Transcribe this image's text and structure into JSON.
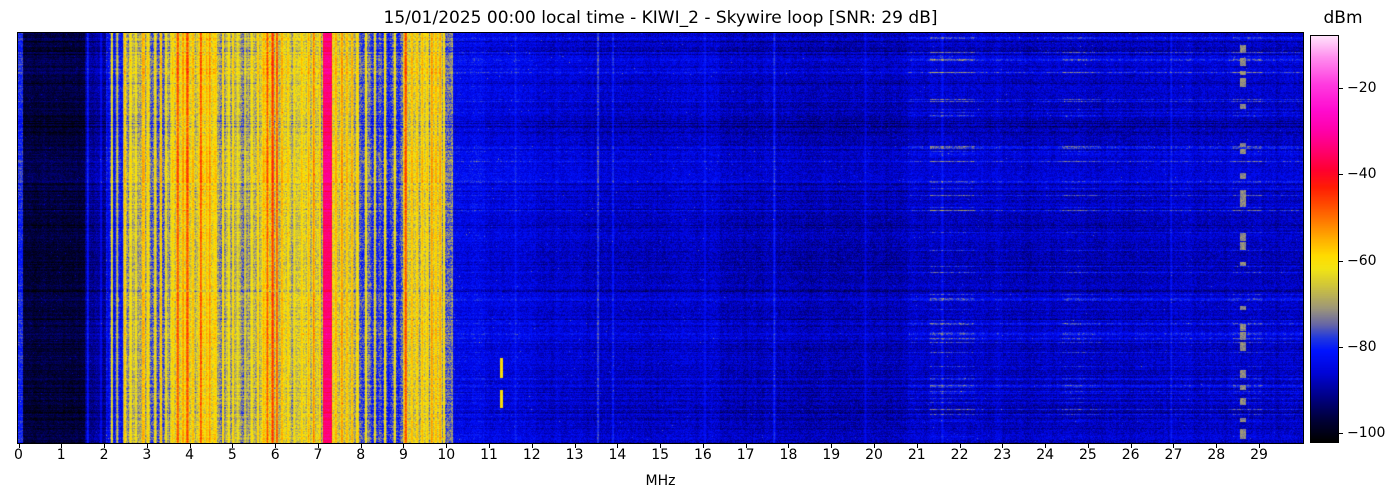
{
  "chart_data": {
    "type": "heatmap",
    "subtype": "spectrogram-waterfall",
    "title": "15/01/2025 00:00 local time - KIWI_2 - Skywire loop [SNR: 29 dB]",
    "xlabel": "MHz",
    "colorbar_label": "dBm",
    "x_range": [
      0,
      30
    ],
    "x_ticks": [
      0,
      1,
      2,
      3,
      4,
      5,
      6,
      7,
      8,
      9,
      10,
      11,
      12,
      13,
      14,
      15,
      16,
      17,
      18,
      19,
      20,
      21,
      22,
      23,
      24,
      25,
      26,
      27,
      28,
      29
    ],
    "value_unit": "dBm",
    "value_range": [
      -102,
      -8
    ],
    "colorbar_ticks": [
      -20,
      -40,
      -60,
      -80,
      -100
    ],
    "colorbar_tick_labels": [
      "−20",
      "−40",
      "−60",
      "−80",
      "−100"
    ],
    "legend_position": "right-colorbar",
    "grid": false,
    "colormap_stops": [
      [
        -102,
        "#000000"
      ],
      [
        -97,
        "#000038"
      ],
      [
        -92,
        "#000080"
      ],
      [
        -86,
        "#0004d8"
      ],
      [
        -81,
        "#0013ff"
      ],
      [
        -78,
        "#2038e0"
      ],
      [
        -75,
        "#6464a8"
      ],
      [
        -71,
        "#9e9878"
      ],
      [
        -66,
        "#cfc43c"
      ],
      [
        -62,
        "#f2e414"
      ],
      [
        -59,
        "#ffdc00"
      ],
      [
        -55,
        "#ffae00"
      ],
      [
        -51,
        "#ff7c00"
      ],
      [
        -47,
        "#ff4a00"
      ],
      [
        -43,
        "#ff1c04"
      ],
      [
        -39,
        "#ff0030"
      ],
      [
        -35,
        "#ff0068"
      ],
      [
        -30,
        "#ff00a8"
      ],
      [
        -25,
        "#ff0cd0"
      ],
      [
        -19,
        "#ff3ce0"
      ],
      [
        -13,
        "#ff8cee"
      ],
      [
        -8,
        "#ffe2fb"
      ]
    ],
    "bands_from_to_base_noise_jitter": [
      [
        -0.5,
        0.1,
        -79,
        3.0,
        1.0
      ],
      [
        0.1,
        1.55,
        -96,
        2.5,
        1.5
      ],
      [
        1.55,
        2.05,
        -90,
        3.0,
        2.0
      ],
      [
        2.05,
        2.5,
        -81,
        4.0,
        4.0
      ],
      [
        2.5,
        3.08,
        -69,
        5.0,
        6.0
      ],
      [
        3.08,
        3.55,
        -74,
        5.0,
        7.0
      ],
      [
        3.55,
        4.65,
        -63,
        5.0,
        7.0
      ],
      [
        4.65,
        5.45,
        -70,
        5.0,
        8.0
      ],
      [
        5.45,
        6.25,
        -65,
        5.0,
        8.0
      ],
      [
        6.25,
        7.14,
        -67,
        5.0,
        8.0
      ],
      [
        7.14,
        7.32,
        -45,
        4.0,
        4.0
      ],
      [
        7.32,
        7.95,
        -65,
        5.0,
        7.0
      ],
      [
        7.95,
        9.0,
        -75,
        5.0,
        6.0
      ],
      [
        9.0,
        9.95,
        -66,
        5.0,
        8.0
      ],
      [
        9.95,
        10.15,
        -73,
        5.0,
        5.0
      ],
      [
        10.15,
        10.9,
        -83,
        3.5,
        1.2
      ],
      [
        10.9,
        12.1,
        -84.5,
        3.5,
        1.2
      ],
      [
        12.1,
        13.2,
        -85.5,
        3.5,
        1.2
      ],
      [
        13.2,
        15.2,
        -86.5,
        3.5,
        1.2
      ],
      [
        15.2,
        16.4,
        -86,
        3.5,
        1.2
      ],
      [
        16.4,
        18.3,
        -87.5,
        3.5,
        1.2
      ],
      [
        18.3,
        20.8,
        -88,
        3.5,
        1.2
      ],
      [
        20.8,
        23.0,
        -86.5,
        3.5,
        1.5
      ],
      [
        23.0,
        26.5,
        -87,
        3.5,
        1.5
      ],
      [
        26.5,
        30.1,
        -86.5,
        3.5,
        1.5
      ]
    ],
    "signals_f_hw_level": [
      [
        1.62,
        0.008,
        -80
      ],
      [
        1.93,
        0.008,
        -83
      ],
      [
        2.18,
        0.01,
        -61
      ],
      [
        2.31,
        0.008,
        -66
      ],
      [
        2.48,
        0.012,
        -56
      ],
      [
        2.62,
        0.012,
        -60
      ],
      [
        2.75,
        0.012,
        -62
      ],
      [
        2.92,
        0.02,
        -55
      ],
      [
        3.02,
        0.012,
        -58
      ],
      [
        3.2,
        0.01,
        -60
      ],
      [
        3.33,
        0.012,
        -57
      ],
      [
        3.45,
        0.01,
        -62
      ],
      [
        3.6,
        0.01,
        -57
      ],
      [
        3.72,
        0.015,
        -47
      ],
      [
        3.85,
        0.01,
        -53
      ],
      [
        3.95,
        0.015,
        -46
      ],
      [
        4.08,
        0.01,
        -56
      ],
      [
        4.26,
        0.012,
        -47
      ],
      [
        4.4,
        0.01,
        -55
      ],
      [
        4.47,
        0.01,
        -52
      ],
      [
        4.6,
        0.01,
        -57
      ],
      [
        4.78,
        0.01,
        -59
      ],
      [
        4.92,
        0.01,
        -61
      ],
      [
        5.02,
        0.008,
        -58
      ],
      [
        5.12,
        0.01,
        -62
      ],
      [
        5.3,
        0.01,
        -64
      ],
      [
        5.45,
        0.01,
        -60
      ],
      [
        5.6,
        0.01,
        -58
      ],
      [
        5.73,
        0.012,
        -55
      ],
      [
        5.82,
        0.012,
        -47
      ],
      [
        5.94,
        0.014,
        -44
      ],
      [
        6.04,
        0.012,
        -48
      ],
      [
        6.16,
        0.01,
        -55
      ],
      [
        6.3,
        0.01,
        -58
      ],
      [
        6.45,
        0.01,
        -59
      ],
      [
        6.62,
        0.01,
        -57
      ],
      [
        6.78,
        0.012,
        -55
      ],
      [
        6.9,
        0.012,
        -51
      ],
      [
        7.05,
        0.008,
        -57
      ],
      [
        7.22,
        0.085,
        -33
      ],
      [
        7.42,
        0.01,
        -55
      ],
      [
        7.56,
        0.012,
        -53
      ],
      [
        7.68,
        0.012,
        -56
      ],
      [
        7.8,
        0.01,
        -55
      ],
      [
        7.92,
        0.01,
        -59
      ],
      [
        8.12,
        0.01,
        -61
      ],
      [
        8.33,
        0.01,
        -63
      ],
      [
        8.57,
        0.01,
        -61
      ],
      [
        8.8,
        0.01,
        -62
      ],
      [
        9.05,
        0.014,
        -46
      ],
      [
        9.2,
        0.01,
        -56
      ],
      [
        9.32,
        0.01,
        -57
      ],
      [
        9.44,
        0.01,
        -55
      ],
      [
        9.56,
        0.01,
        -57
      ],
      [
        9.66,
        0.012,
        -53
      ],
      [
        9.76,
        0.01,
        -56
      ],
      [
        9.86,
        0.012,
        -54
      ],
      [
        9.95,
        0.01,
        -59
      ],
      [
        11.62,
        0.008,
        -80
      ],
      [
        13.55,
        0.01,
        -77
      ],
      [
        13.9,
        0.008,
        -80
      ],
      [
        16.05,
        0.008,
        -82
      ],
      [
        17.67,
        0.01,
        -79
      ],
      [
        19.8,
        0.008,
        -83
      ],
      [
        21.6,
        0.01,
        -81
      ],
      [
        26.95,
        0.008,
        -81
      ]
    ],
    "dash_columns": [
      {
        "f": 11.3,
        "hw": 0.022,
        "level": -60,
        "duty": 0.1,
        "seg": 14
      },
      {
        "f": 28.62,
        "hw": 0.055,
        "level": -72,
        "duty": 0.35,
        "seg": 6
      }
    ],
    "streak_bands": [
      {
        "from": -0.5,
        "to": 10.2,
        "gain": 0.12
      },
      {
        "from": 10.2,
        "to": 20.8,
        "gain": 0.28
      },
      {
        "from": 20.8,
        "to": 21.3,
        "gain": 0.55
      },
      {
        "from": 21.3,
        "to": 22.35,
        "gain": 1.0
      },
      {
        "from": 22.35,
        "to": 24.4,
        "gain": 0.55
      },
      {
        "from": 24.4,
        "to": 25.3,
        "gain": 0.9
      },
      {
        "from": 25.3,
        "to": 26.6,
        "gain": 0.6
      },
      {
        "from": 26.6,
        "to": 28.4,
        "gain": 0.55
      },
      {
        "from": 28.4,
        "to": 29.1,
        "gain": 0.85
      },
      {
        "from": 29.1,
        "to": 30.1,
        "gain": 0.6
      }
    ],
    "render": {
      "seed": 11,
      "row_noise_db": 1.6,
      "slow_row_drift_db": 1.8,
      "streak_row_probability": 0.12,
      "streak_min_db": 4,
      "streak_max_db": 13,
      "dark_row_probability": 0.1,
      "spike_probability": 0.006
    }
  }
}
